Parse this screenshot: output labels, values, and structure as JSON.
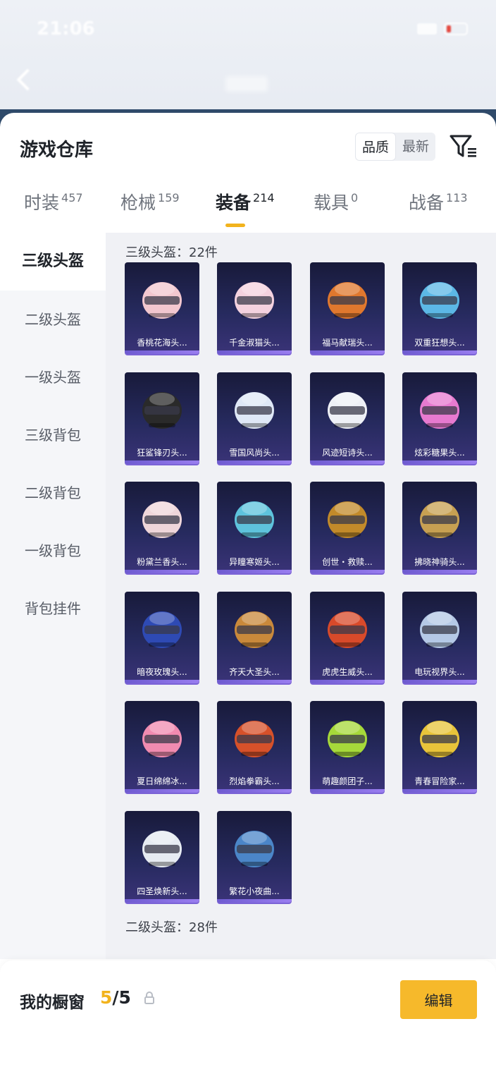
{
  "status": {
    "time": "21:06"
  },
  "sheet": {
    "title": "游戏仓库",
    "sort": [
      "品质",
      "最新"
    ],
    "tabs": [
      {
        "label": "时装",
        "count": "457"
      },
      {
        "label": "枪械",
        "count": "159"
      },
      {
        "label": "装备",
        "count": "214"
      },
      {
        "label": "载具",
        "count": "0"
      },
      {
        "label": "战备",
        "count": "113"
      }
    ],
    "categories": [
      "三级头盔",
      "二级头盔",
      "一级头盔",
      "三级背包",
      "二级背包",
      "一级背包",
      "背包挂件"
    ],
    "sections": [
      {
        "title": "三级头盔：22件",
        "items": [
          {
            "name": "香桃花海头...",
            "color": "#f2c7cf"
          },
          {
            "name": "千金淑猫头...",
            "color": "#f4d2df"
          },
          {
            "name": "福马献瑞头...",
            "color": "#e0782e"
          },
          {
            "name": "双重狂想头...",
            "color": "#5cb8e6"
          },
          {
            "name": "狂鲨锋刃头...",
            "color": "#2a2a2a"
          },
          {
            "name": "雪国风尚头...",
            "color": "#dfe8f6"
          },
          {
            "name": "风迹短诗头...",
            "color": "#eef0f6"
          },
          {
            "name": "炫彩糖果头...",
            "color": "#e77ad0"
          },
          {
            "name": "粉黛兰香头...",
            "color": "#efd6da"
          },
          {
            "name": "异瞳寒姬头...",
            "color": "#5ec3dc"
          },
          {
            "name": "创世・救赎...",
            "color": "#c28a2a"
          },
          {
            "name": "拂晓神骑头...",
            "color": "#c7a052"
          },
          {
            "name": "暗夜玫瑰头...",
            "color": "#2e4ab4"
          },
          {
            "name": "齐天大圣头...",
            "color": "#c9893b"
          },
          {
            "name": "虎虎生威头...",
            "color": "#d84a2a"
          },
          {
            "name": "电玩视界头...",
            "color": "#b5c9e6"
          },
          {
            "name": "夏日绵绵冰...",
            "color": "#f08bb0"
          },
          {
            "name": "烈焰拳霸头...",
            "color": "#d6512a"
          },
          {
            "name": "萌趣颜团子...",
            "color": "#a6d93a"
          },
          {
            "name": "青春冒险家...",
            "color": "#e8c43a"
          },
          {
            "name": "四圣焕新头...",
            "color": "#e6ebf2"
          },
          {
            "name": "繁花小夜曲...",
            "color": "#4b86c8"
          }
        ]
      },
      {
        "title": "二级头盔：28件",
        "items": []
      }
    ]
  },
  "showcase": {
    "title": "我的橱窗",
    "current": "5",
    "total": "/5",
    "edit_label": "编辑"
  }
}
